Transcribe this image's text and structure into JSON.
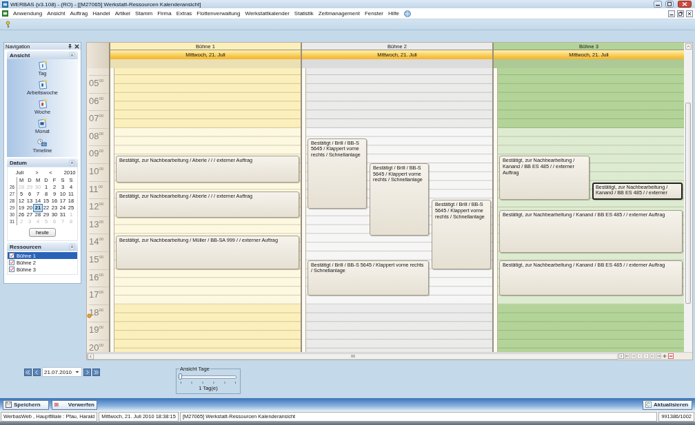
{
  "window": {
    "title": "WERBAS (v3.108) - (RO) - [[M27065] Werkstatt-Ressourcen Kalenderansicht]"
  },
  "menu": [
    "Anwendung",
    "Ansicht",
    "Auftrag",
    "Handel",
    "Artikel",
    "Stamm",
    "Firma",
    "Extras",
    "Flottenverwaltung",
    "Werkstattkalender",
    "Statistik",
    "Zeitmanagement",
    "Fenster",
    "Hilfe"
  ],
  "navigation": {
    "title": "Navigation",
    "views": {
      "title": "Ansicht",
      "expanded": true,
      "items": [
        {
          "label": "Tag",
          "kind": "day"
        },
        {
          "label": "Arbeitswoche",
          "kind": "workweek"
        },
        {
          "label": "Woche",
          "kind": "week"
        },
        {
          "label": "Monat",
          "kind": "month"
        },
        {
          "label": "Timeline",
          "kind": "timeline"
        }
      ]
    },
    "date_picker": {
      "title": "Datum",
      "expanded": true,
      "month": "Juli",
      "next_month": ">",
      "prev_year": "<",
      "year": "2010",
      "weekdays": [
        "M",
        "D",
        "M",
        "D",
        "F",
        "S",
        "S"
      ],
      "weeks": [
        {
          "week": "26",
          "days": [
            {
              "day": "28",
              "outside": true,
              "selected": false
            },
            {
              "day": "29",
              "outside": true,
              "selected": false
            },
            {
              "day": "30",
              "outside": true,
              "selected": false
            },
            {
              "day": "1",
              "outside": false,
              "selected": false
            },
            {
              "day": "2",
              "outside": false,
              "selected": false
            },
            {
              "day": "3",
              "outside": false,
              "selected": false
            },
            {
              "day": "4",
              "outside": false,
              "selected": false
            }
          ]
        },
        {
          "week": "27",
          "days": [
            {
              "day": "5",
              "outside": false,
              "selected": false
            },
            {
              "day": "6",
              "outside": false,
              "selected": false
            },
            {
              "day": "7",
              "outside": false,
              "selected": false
            },
            {
              "day": "8",
              "outside": false,
              "selected": false
            },
            {
              "day": "9",
              "outside": false,
              "selected": false
            },
            {
              "day": "10",
              "outside": false,
              "selected": false
            },
            {
              "day": "11",
              "outside": false,
              "selected": false
            }
          ]
        },
        {
          "week": "28",
          "days": [
            {
              "day": "12",
              "outside": false,
              "selected": false
            },
            {
              "day": "13",
              "outside": false,
              "selected": false
            },
            {
              "day": "14",
              "outside": false,
              "selected": false
            },
            {
              "day": "15",
              "outside": false,
              "selected": false
            },
            {
              "day": "16",
              "outside": false,
              "selected": false
            },
            {
              "day": "17",
              "outside": false,
              "selected": false
            },
            {
              "day": "18",
              "outside": false,
              "selected": false
            }
          ]
        },
        {
          "week": "29",
          "days": [
            {
              "day": "19",
              "outside": false,
              "selected": false
            },
            {
              "day": "20",
              "outside": false,
              "selected": false
            },
            {
              "day": "21",
              "outside": false,
              "selected": true
            },
            {
              "day": "22",
              "outside": false,
              "selected": false
            },
            {
              "day": "23",
              "outside": false,
              "selected": false
            },
            {
              "day": "24",
              "outside": false,
              "selected": false
            },
            {
              "day": "25",
              "outside": false,
              "selected": false
            }
          ]
        },
        {
          "week": "30",
          "days": [
            {
              "day": "26",
              "outside": false,
              "selected": false
            },
            {
              "day": "27",
              "outside": false,
              "selected": false
            },
            {
              "day": "28",
              "outside": false,
              "selected": false
            },
            {
              "day": "29",
              "outside": false,
              "selected": false
            },
            {
              "day": "30",
              "outside": false,
              "selected": false
            },
            {
              "day": "31",
              "outside": false,
              "selected": false
            },
            {
              "day": "1",
              "outside": true,
              "selected": false
            }
          ]
        },
        {
          "week": "31",
          "days": [
            {
              "day": "2",
              "outside": true,
              "selected": false
            },
            {
              "day": "3",
              "outside": true,
              "selected": false
            },
            {
              "day": "4",
              "outside": true,
              "selected": false
            },
            {
              "day": "5",
              "outside": true,
              "selected": false
            },
            {
              "day": "6",
              "outside": true,
              "selected": false
            },
            {
              "day": "7",
              "outside": true,
              "selected": false
            },
            {
              "day": "8",
              "outside": true,
              "selected": false
            }
          ]
        }
      ],
      "today_button": "heute"
    },
    "resources": {
      "title": "Ressourcen",
      "expanded": true,
      "items": [
        {
          "label": "Bühne 1",
          "checked": true,
          "selected": true
        },
        {
          "label": "Bühne 2",
          "checked": true,
          "selected": false
        },
        {
          "label": "Bühne 3",
          "checked": true,
          "selected": false
        }
      ]
    }
  },
  "calendar": {
    "time_labels": [
      "05$^{00}$",
      "06$^{00}$",
      "07$^{00}$",
      "08$^{00}$",
      "09$^{00}$",
      "10$^{00}$",
      "11$^{00}$",
      "12$^{00}$",
      "13$^{00}$",
      "14$^{00}$",
      "15$^{00}$",
      "16$^{00}$",
      "17$^{00}$",
      "18$^{00}$",
      "19$^{00}$",
      "20$^{00}$"
    ],
    "working_hours_shaded": true,
    "current_time_marker": true,
    "columns": [
      {
        "resource": "Bühne 1",
        "date": "Mittwoch, 21. Juli",
        "color": "#fbefbb",
        "appointments": [
          {
            "text": "Bestätigt, zur Nachbearbeitung / Aberle / / / externer Auftrag",
            "selected": false
          },
          {
            "text": "Bestätigt, zur Nachbearbeitung / Aberle / / / externer Auftrag",
            "selected": false
          },
          {
            "text": "Bestätigt, zur Nachbearbeitung / Müller / BB-SA 999 / / externer Auftrag",
            "selected": false
          }
        ]
      },
      {
        "resource": "Bühne 2",
        "date": "Mittwoch, 21. Juli",
        "color": "#ebebeb",
        "appointments": [
          {
            "text": "Bestätigt / Brill / BB-S 5645 / Klappert vorne rechts / Schnellanlage",
            "selected": false
          },
          {
            "text": "Bestätigt / Brill / BB-S 5645 / Klappert vorne rechts / Schnellanlage",
            "selected": false
          },
          {
            "text": "Bestätigt / Brill / BB-S 5645 / Klappert vorne rechts / Schnellanlage",
            "selected": false
          },
          {
            "text": "Bestätigt / Brill / BB-S 5645 / Klappert vorne rechts / Schnellanlage",
            "selected": false
          }
        ]
      },
      {
        "resource": "Bühne 3",
        "date": "Mittwoch, 21. Juli",
        "color": "#b3d498",
        "appointments": [
          {
            "text": "Bestätigt, zur Nachbearbeitung / Kanand / BB ES 485 / / externer Auftrag",
            "selected": false
          },
          {
            "text": "Bestätigt, zur Nachbearbeitung / Kanand / BB ES 485 / / externer",
            "selected": true
          },
          {
            "text": "Bestätigt, zur Nachbearbeitung / Kanand / BB ES 485 / / externer Auftrag",
            "selected": false
          },
          {
            "text": "Bestätigt, zur Nachbearbeitung / Kanand / BB ES 485 / / externer Auftrag",
            "selected": false
          }
        ]
      }
    ]
  },
  "date_navigation": {
    "date": "21.07.2010"
  },
  "days_slider": {
    "label": "Ansicht Tage",
    "level": 0,
    "reading": "1 Tag(e)"
  },
  "actions": [
    {
      "label": "Speichern",
      "kind": "save"
    },
    {
      "label": "Verwerfen",
      "kind": "discard"
    },
    {
      "label": "Aktualisieren",
      "kind": "refresh"
    }
  ],
  "status_bar": [
    "WerbasWeb , Hauptfiliale : Pfau, Harald",
    "Mittwoch, 21. Juli 2010 18:38:15",
    "[M27065] Werkstatt-Ressourcen Kalenderansicht",
    "991386/1002"
  ]
}
